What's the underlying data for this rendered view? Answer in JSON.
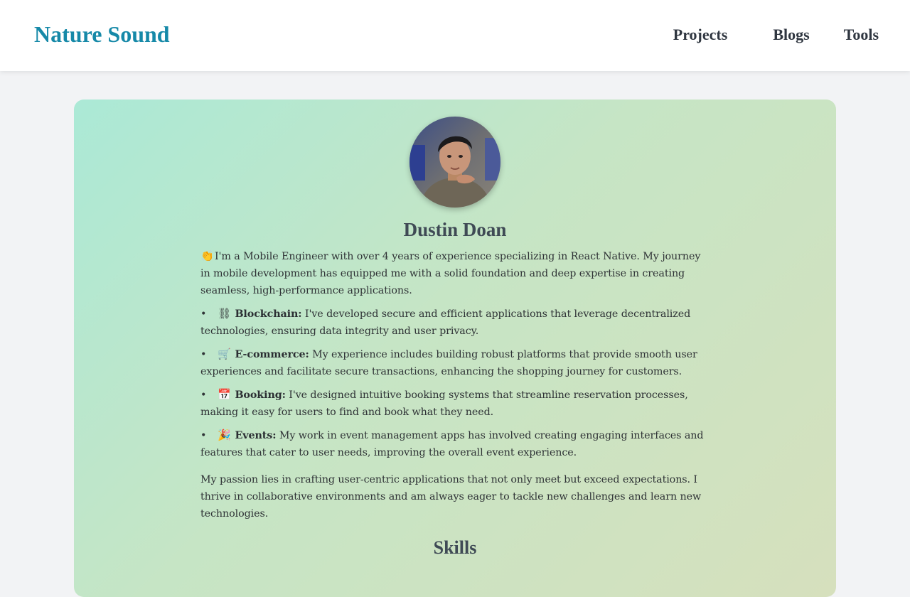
{
  "header": {
    "brand": "Nature Sound",
    "nav": {
      "projects": "Projects",
      "blogs": "Blogs",
      "tools": "Tools"
    }
  },
  "profile": {
    "name": "Dustin Doan",
    "intro_emoji": "👏",
    "intro": "I'm a Mobile Engineer with over 4 years of experience specializing in React Native. My journey in mobile development has equipped me with a solid foundation and deep expertise in creating seamless, high-performance applications.",
    "bullet_char": "•",
    "items": [
      {
        "emoji": "⛓",
        "title": "Blockchain:",
        "text": " I've developed secure and efficient applications that leverage decentralized technologies, ensuring data integrity and user privacy."
      },
      {
        "emoji": "🛒",
        "title": "E-commerce:",
        "text": " My experience includes building robust platforms that provide smooth user experiences and facilitate secure transactions, enhancing the shopping journey for customers."
      },
      {
        "emoji": "📅",
        "title": "Booking:",
        "text": " I've designed intuitive booking systems that streamline reservation processes, making it easy for users to find and book what they need."
      },
      {
        "emoji": "🎉",
        "title": "Events:",
        "text": " My work in event management apps has involved creating engaging interfaces and features that cater to user needs, improving the overall event experience."
      }
    ],
    "closing": "My passion lies in crafting user-centric applications that not only meet but exceed expectations. I thrive in collaborative environments and am always eager to tackle new challenges and learn new technologies.",
    "skills_heading": "Skills"
  },
  "colors": {
    "brand": "#1689a8",
    "card_gradient_start": "#abe9d6",
    "card_gradient_end": "#d6e0bd"
  },
  "icons": {
    "avatar": "profile-photo"
  }
}
